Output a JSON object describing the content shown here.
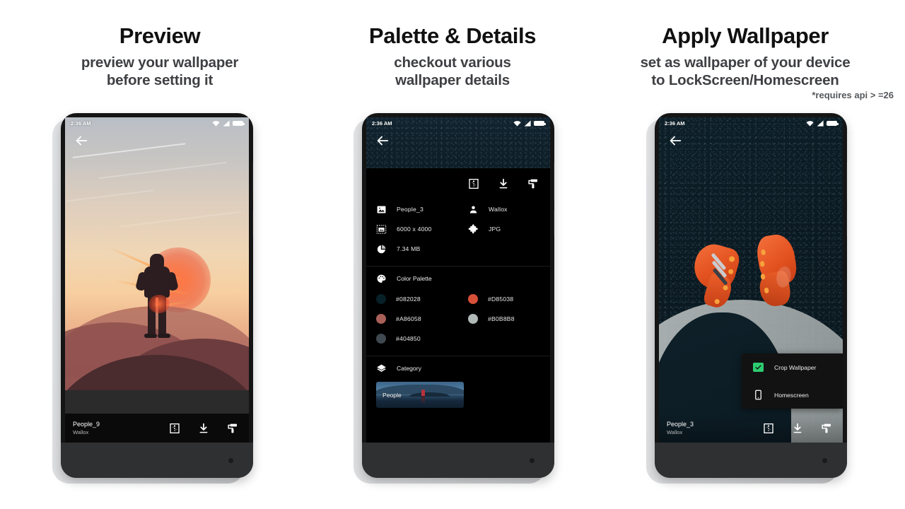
{
  "panels": [
    {
      "id": "preview",
      "title": "Preview",
      "subtitle_line1": "preview your wallpaper",
      "subtitle_line2": "before setting it",
      "note": "",
      "phone": {
        "status": {
          "time": "2:36 AM",
          "wifi": "wifi-icon",
          "signal": "signal-icon",
          "battery": "battery-icon"
        },
        "back": "back-arrow-icon",
        "wallpaper": "sunset-hiker-photo",
        "infobar": {
          "title": "People_9",
          "author": "Wallox",
          "actions": [
            "halftone-preview-icon",
            "download-icon",
            "paint-roller-icon"
          ]
        }
      }
    },
    {
      "id": "palette-details",
      "title": "Palette & Details",
      "subtitle_line1": "checkout various",
      "subtitle_line2": "wallpaper details",
      "note": "",
      "phone": {
        "status": {
          "time": "2:36 AM",
          "wifi": "wifi-icon",
          "signal": "signal-icon",
          "battery": "battery-icon"
        },
        "back": "back-arrow-icon",
        "wallpaper": "asphalt-texture-strip",
        "sheet": {
          "actions": [
            "halftone-preview-icon",
            "download-icon",
            "paint-roller-icon"
          ],
          "details": [
            {
              "icon": "image-icon",
              "value": "People_3"
            },
            {
              "icon": "person-icon",
              "value": "Wallox"
            },
            {
              "icon": "resolution-icon",
              "value": "6000 x 4000"
            },
            {
              "icon": "puzzle-icon",
              "value": "JPG"
            },
            {
              "icon": "pie-chart-icon",
              "value": "7.34 MB"
            }
          ],
          "palette_header": {
            "icon": "palette-icon",
            "label": "Color Palette"
          },
          "palette": [
            {
              "hex": "#082028",
              "label": "#082028"
            },
            {
              "hex": "#D85038",
              "label": "#D85038"
            },
            {
              "hex": "#A86058",
              "label": "#A86058"
            },
            {
              "hex": "#B0B8B8",
              "label": "#B0B8B8"
            },
            {
              "hex": "#404850",
              "label": "#404850"
            }
          ],
          "category_header": {
            "icon": "layers-icon",
            "label": "Category"
          },
          "category_chip": "People"
        }
      }
    },
    {
      "id": "apply-wallpaper",
      "title": "Apply Wallpaper",
      "subtitle_line1": "set as wallpaper of your device",
      "subtitle_line2": "to LockScreen/Homescreen",
      "note": "*requires api > =26",
      "phone": {
        "status": {
          "time": "2:36 AM",
          "wifi": "wifi-icon",
          "signal": "signal-icon",
          "battery": "battery-icon"
        },
        "back": "back-arrow-icon",
        "wallpaper": "orange-soccer-cleats-photo",
        "menu": [
          {
            "icon": "checkbox-checked-icon",
            "label": "Crop Wallpaper",
            "checked": true,
            "accent": "#2ecc71"
          },
          {
            "icon": "phone-icon",
            "label": "Homescreen",
            "checked": false
          }
        ],
        "infobar": {
          "title": "People_3",
          "author": "Wallox",
          "actions": [
            "halftone-preview-icon",
            "download-icon",
            "paint-roller-icon"
          ]
        }
      }
    }
  ],
  "theme": {
    "background": "#ffffff",
    "title_color": "#101010",
    "subtitle_color": "#3f4043",
    "sheet_background": "#000000",
    "accent_green": "#2ecc71"
  }
}
